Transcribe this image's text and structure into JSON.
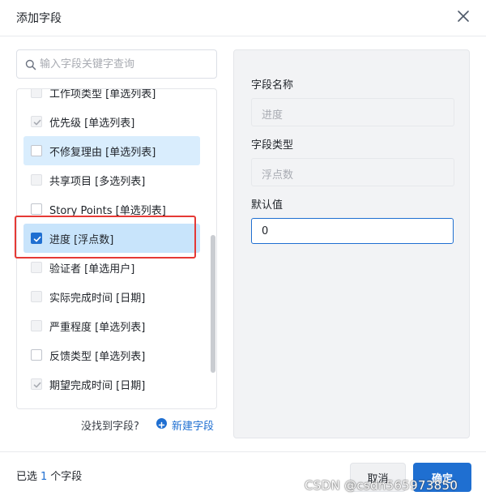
{
  "dialog": {
    "title": "添加字段"
  },
  "search": {
    "placeholder": "输入字段关键字查询"
  },
  "fields": [
    {
      "label": "工作项类型 [单选列表]",
      "state": "disabled"
    },
    {
      "label": "优先级 [单选列表]",
      "state": "checked-disabled"
    },
    {
      "label": "不修复理由 [单选列表]",
      "state": "unchecked",
      "highlight": true
    },
    {
      "label": "共享项目 [多选列表]",
      "state": "disabled"
    },
    {
      "label": "Story Points [单选列表]",
      "state": "unchecked"
    },
    {
      "label": "进度 [浮点数]",
      "state": "checked",
      "selected": true
    },
    {
      "label": "验证者 [单选用户]",
      "state": "disabled"
    },
    {
      "label": "实际完成时间 [日期]",
      "state": "disabled"
    },
    {
      "label": "严重程度 [单选列表]",
      "state": "disabled"
    },
    {
      "label": "反馈类型 [单选列表]",
      "state": "unchecked"
    },
    {
      "label": "期望完成时间 [日期]",
      "state": "checked-disabled"
    }
  ],
  "not_found": {
    "text": "没找到字段?",
    "new_field": "新建字段"
  },
  "form": {
    "name_label": "字段名称",
    "name_value": "进度",
    "type_label": "字段类型",
    "type_value": "浮点数",
    "default_label": "默认值",
    "default_value": "0"
  },
  "footer": {
    "selected_prefix": "已选",
    "selected_count": "1",
    "selected_suffix": "个字段",
    "cancel": "取消",
    "confirm": "确定"
  },
  "watermark": "CSDN @csdn565973850",
  "colors": {
    "accent": "#1f6fd1",
    "highlight_row": "#d9edfd",
    "annotation": "#e53935"
  },
  "icons": {
    "close": "close-icon",
    "search": "search-icon",
    "add": "plus-circle-icon",
    "check": "check-icon"
  }
}
